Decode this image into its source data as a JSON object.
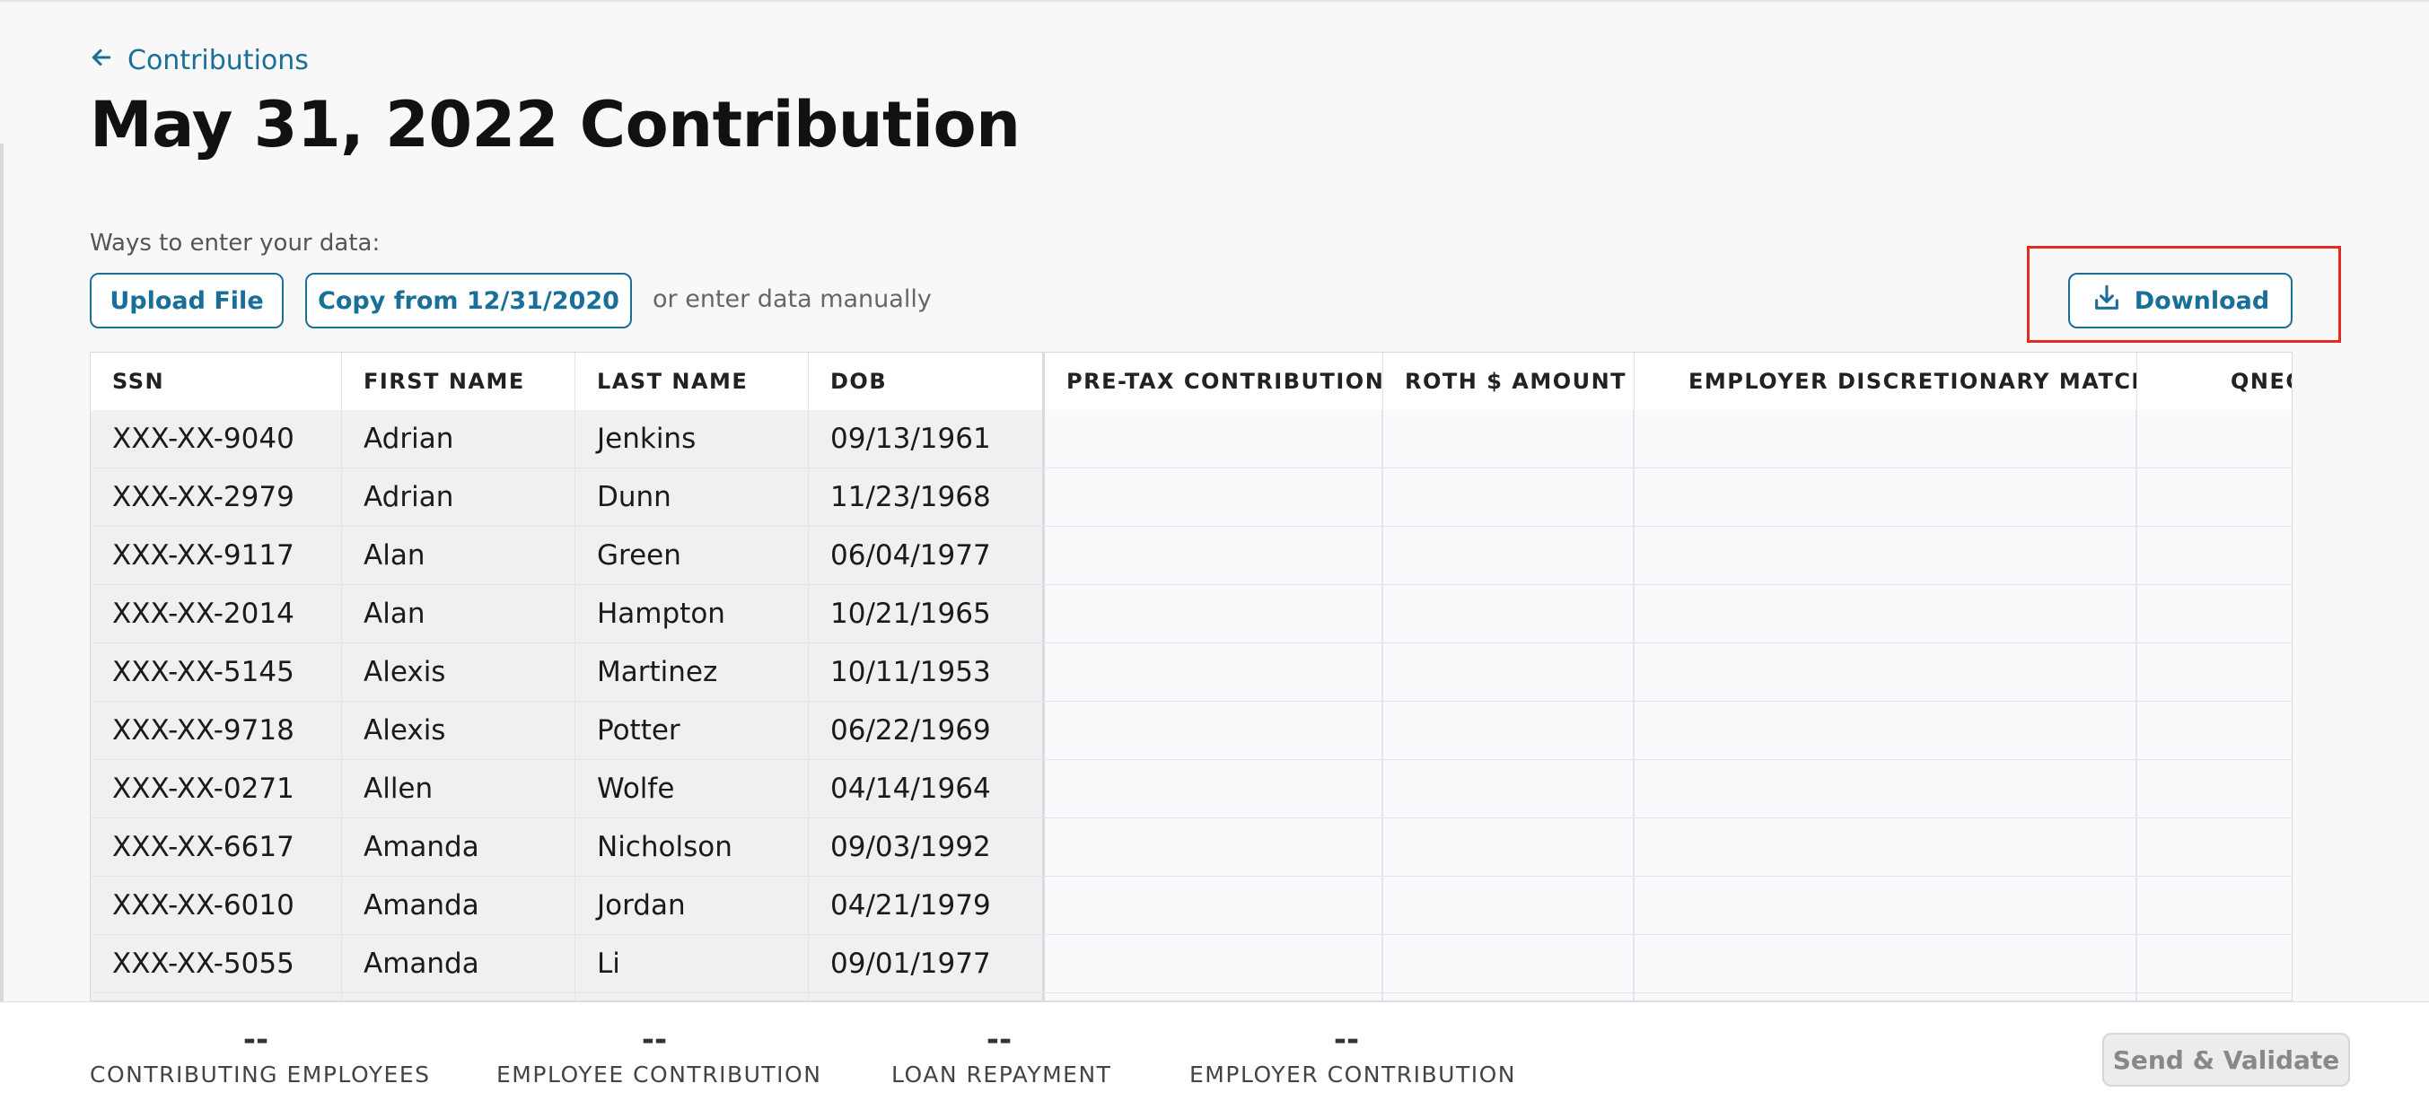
{
  "breadcrumb": {
    "back_label": "Contributions"
  },
  "page_title": "May 31, 2022 Contribution",
  "data_entry": {
    "prompt": "Ways to enter your data:",
    "upload_label": "Upload File",
    "copy_label": "Copy from 12/31/2020",
    "manual_text": "or enter data manually"
  },
  "toolbar": {
    "download_label": "Download"
  },
  "table": {
    "headers": {
      "ssn": "SSN",
      "first": "FIRST NAME",
      "last": "LAST NAME",
      "dob": "DOB",
      "pretax": "PRE-TAX CONTRIBUTION",
      "roth": "ROTH $ AMOUNT",
      "match": "EMPLOYER DISCRETIONARY MATCH",
      "qnec": "QNEC"
    },
    "rows": [
      {
        "ssn": "XXX-XX-9040",
        "first": "Adrian",
        "last": "Jenkins",
        "dob": "09/13/1961"
      },
      {
        "ssn": "XXX-XX-2979",
        "first": "Adrian",
        "last": "Dunn",
        "dob": "11/23/1968"
      },
      {
        "ssn": "XXX-XX-9117",
        "first": "Alan",
        "last": "Green",
        "dob": "06/04/1977"
      },
      {
        "ssn": "XXX-XX-2014",
        "first": "Alan",
        "last": "Hampton",
        "dob": "10/21/1965"
      },
      {
        "ssn": "XXX-XX-5145",
        "first": "Alexis",
        "last": "Martinez",
        "dob": "10/11/1953"
      },
      {
        "ssn": "XXX-XX-9718",
        "first": "Alexis",
        "last": "Potter",
        "dob": "06/22/1969"
      },
      {
        "ssn": "XXX-XX-0271",
        "first": "Allen",
        "last": "Wolfe",
        "dob": "04/14/1964"
      },
      {
        "ssn": "XXX-XX-6617",
        "first": "Amanda",
        "last": "Nicholson",
        "dob": "09/03/1992"
      },
      {
        "ssn": "XXX-XX-6010",
        "first": "Amanda",
        "last": "Jordan",
        "dob": "04/21/1979"
      },
      {
        "ssn": "XXX-XX-5055",
        "first": "Amanda",
        "last": "Li",
        "dob": "09/01/1977"
      }
    ]
  },
  "summary": {
    "contributing_employees": {
      "value": "--",
      "label": "CONTRIBUTING EMPLOYEES"
    },
    "employee_contribution": {
      "value": "--",
      "label": "EMPLOYEE CONTRIBUTION"
    },
    "loan_repayment": {
      "value": "--",
      "label": "LOAN REPAYMENT"
    },
    "employer_contribution": {
      "value": "--",
      "label": "EMPLOYER CONTRIBUTION"
    }
  },
  "actions": {
    "send_validate_label": "Send & Validate"
  },
  "colors": {
    "accent": "#1a6f98",
    "highlight": "#e32b22"
  }
}
